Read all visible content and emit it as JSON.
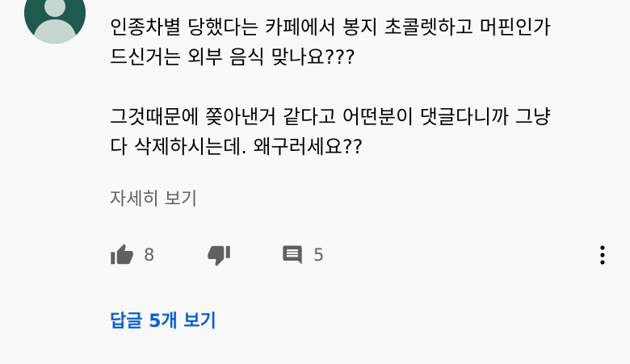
{
  "comment": {
    "author_meta": "···",
    "lines": [
      "인종차별 당했다는 카페에서 봉지 초콜렛하고 머핀인가",
      "드신거는 외부 음식 맞나요???",
      "그것때문에 쫒아낸거 같다고 어떤분이 댓글다니까 그냥",
      "다 삭제하시는데. 왜구러세요??"
    ],
    "read_more": "자세히 보기"
  },
  "actions": {
    "like_count": "8",
    "reply_count": "5"
  },
  "replies_link": "답글 5개 보기",
  "colors": {
    "avatar_bg": "#1f5a4f",
    "avatar_fg": "#c8d6d2",
    "link": "#065fd4",
    "muted": "#606060"
  }
}
